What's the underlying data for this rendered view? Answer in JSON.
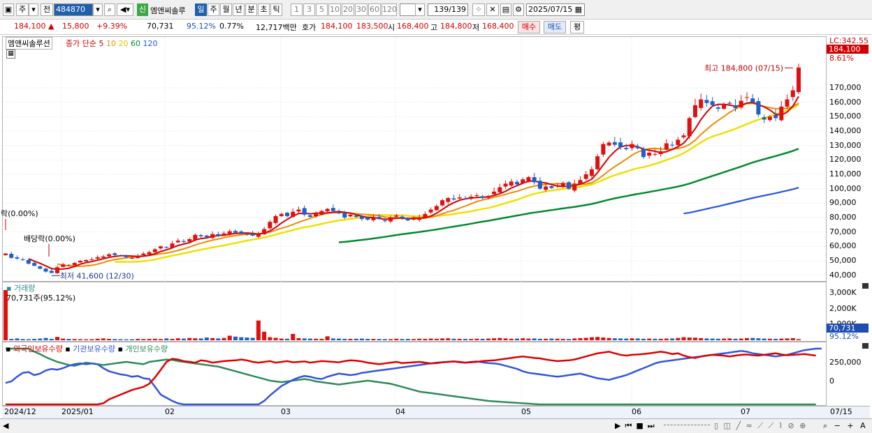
{
  "toolbar": {
    "market": "주",
    "prefix": "전",
    "code": "484870",
    "new_badge": "신",
    "stock_name": "엠앤씨솔루",
    "periods": [
      "일",
      "주",
      "월",
      "년",
      "분",
      "초",
      "틱"
    ],
    "selected_period": "일",
    "intervals": [
      "1",
      "3",
      "5",
      "10",
      "20",
      "30",
      "60",
      "120"
    ],
    "count": "139",
    "total": "/139",
    "date": "2025/07/15"
  },
  "quote": {
    "price": "184,100",
    "change": "15,800",
    "pct": "+9.39%",
    "volume": "70,731",
    "vol_ratio": "95.12%",
    "turnover": "0.77%",
    "amount": "12,717백만",
    "hoga_label": "호가",
    "hoga_bid": "184,100",
    "hoga_ask": "183,500",
    "open_label": "시",
    "open": "168,400",
    "high_label": "고",
    "high": "184,800",
    "low_label": "저",
    "low": "168,400",
    "buy": "매수",
    "sell": "매도",
    "avg": "평"
  },
  "chart_data": [
    {
      "type": "candlestick",
      "title": "엠앤씨솔루션",
      "legend": [
        "종가 단순 5",
        "10",
        "20",
        "60",
        "120"
      ],
      "legend_colors": [
        "#d00000",
        "#ee8a00",
        "#f0e000",
        "#008a2e",
        "#2255dd"
      ],
      "series_5_10_20": [
        "5",
        "10",
        "20"
      ],
      "current_marker": "184,100",
      "lc_label": "LC:342.55",
      "pct_label": "8.61%",
      "annotations": {
        "high": "최고 184,800 (07/15)",
        "low": "최저 41,600 (12/30)",
        "div1": "배당락(0.00%)",
        "div2": "락(0.00%)"
      },
      "ylim": [
        35000,
        190000
      ],
      "yticks": [
        "170,000",
        "160,000",
        "150,000",
        "140,000",
        "130,000",
        "120,000",
        "110,000",
        "100,000",
        "90,000",
        "80,000",
        "70,000",
        "60,000",
        "50,000",
        "40,000"
      ],
      "close": [
        55000,
        52000,
        51500,
        50500,
        48000,
        46500,
        44500,
        42500,
        41600,
        45500,
        47500,
        47000,
        48500,
        50000,
        50500,
        51000,
        52500,
        53000,
        54500,
        54000,
        53500,
        52500,
        52000,
        53500,
        55000,
        56000,
        58000,
        60000,
        59000,
        62000,
        64000,
        63000,
        65000,
        68000,
        67000,
        66500,
        68500,
        67500,
        69000,
        70500,
        69500,
        69000,
        68500,
        67500,
        68500,
        72000,
        77000,
        81000,
        82500,
        81000,
        84000,
        85500,
        82000,
        80500,
        83000,
        84500,
        86000,
        84500,
        83000,
        80000,
        82000,
        80500,
        79000,
        78500,
        80000,
        79000,
        77500,
        80000,
        81500,
        79500,
        78000,
        79000,
        80000,
        82500,
        85500,
        88000,
        92000,
        93500,
        92500,
        94000,
        93000,
        94500,
        95500,
        93500,
        95000,
        98000,
        101000,
        103500,
        105000,
        103000,
        106500,
        108000,
        104500,
        100000,
        101500,
        100500,
        102500,
        104000,
        100000,
        103500,
        106000,
        110000,
        113500,
        122500,
        131000,
        132000,
        130500,
        129000,
        127500,
        131000,
        128000,
        122000,
        125000,
        124000,
        126000,
        131500,
        130000,
        134000,
        137000,
        149000,
        158000,
        162000,
        159500,
        158000,
        155500,
        158000,
        159000,
        156000,
        161000,
        163500,
        160000,
        151500,
        148000,
        150000,
        149000,
        157000,
        162000,
        168300,
        184100
      ],
      "ma60_start_index": 58,
      "ma120_start_index": 118
    },
    {
      "type": "bar",
      "title": "거래량",
      "annotation": "70,731주(95.12%)",
      "yticks": [
        "3,000K",
        "2,000K",
        "1,000K"
      ],
      "current_label": "70,731",
      "current_pct": "95.12%",
      "values_k": [
        3300,
        90,
        120,
        80,
        70,
        90,
        110,
        150,
        95,
        220,
        110,
        90,
        80,
        70,
        60,
        70,
        100,
        120,
        90,
        80,
        70,
        60,
        70,
        90,
        80,
        90,
        100,
        80,
        120,
        90,
        130,
        110,
        150,
        130,
        120,
        180,
        140,
        120,
        150,
        300,
        240,
        200,
        180,
        160,
        1300,
        560,
        200,
        160,
        110,
        100,
        420,
        140,
        120,
        110,
        100,
        90,
        260,
        120,
        110,
        95,
        90,
        100,
        110,
        95,
        90,
        85,
        80,
        75,
        100,
        85,
        90,
        80,
        100,
        90,
        110,
        95,
        120,
        130,
        100,
        95,
        90,
        85,
        100,
        95,
        110,
        130,
        150,
        120,
        100,
        110,
        130,
        110,
        120,
        100,
        95,
        110,
        100,
        90,
        85,
        120,
        140,
        160,
        200,
        220,
        180,
        150,
        130,
        120,
        110,
        130,
        120,
        100,
        110,
        100,
        95,
        110,
        120,
        150,
        200,
        180,
        170,
        140,
        120,
        110,
        100,
        110,
        120,
        100,
        110,
        140,
        150,
        130,
        110,
        100,
        95,
        110,
        120,
        140,
        70
      ]
    },
    {
      "type": "line",
      "title": "외국인보유수량",
      "legend": [
        "외국인보유수량",
        "기관보유수량",
        "개인보유수량"
      ],
      "legend_colors": [
        "#dd0000",
        "#3355dd",
        "#2e8b57"
      ],
      "yticks": [
        "250,000",
        "0"
      ],
      "foreign": [
        -560000,
        -580000,
        -600000,
        -590000,
        -620000,
        -630000,
        -610000,
        -600000,
        -590000,
        -560000,
        -540000,
        -520000,
        -500000,
        -470000,
        -430000,
        -380000,
        -330000,
        -280000,
        -230000,
        -200000,
        -170000,
        -140000,
        -110000,
        -90000,
        -70000,
        -30000,
        50000,
        150000,
        250000,
        290000,
        280000,
        260000,
        250000,
        240000,
        270000,
        260000,
        240000,
        250000,
        260000,
        265000,
        270000,
        280000,
        270000,
        250000,
        240000,
        250000,
        260000,
        240000,
        250000,
        260000,
        245000,
        250000,
        255000,
        240000,
        250000,
        260000,
        255000,
        250000,
        245000,
        260000,
        270000,
        265000,
        255000,
        240000,
        230000,
        220000,
        230000,
        240000,
        250000,
        235000,
        240000,
        245000,
        250000,
        240000,
        230000,
        235000,
        245000,
        250000,
        255000,
        250000,
        240000,
        245000,
        250000,
        260000,
        265000,
        270000,
        280000,
        290000,
        300000,
        310000,
        320000,
        310000,
        300000,
        295000,
        280000,
        270000,
        260000,
        265000,
        270000,
        280000,
        300000,
        320000,
        340000,
        360000,
        370000,
        380000,
        360000,
        340000,
        330000,
        340000,
        345000,
        350000,
        360000,
        370000,
        380000,
        370000,
        350000,
        360000,
        330000,
        310000,
        300000,
        320000,
        330000,
        340000,
        335000,
        330000,
        320000,
        330000,
        340000,
        345000,
        335000,
        330000,
        340000,
        350000,
        360000,
        345000,
        335000,
        340000,
        345000,
        350000,
        340000,
        330000
      ],
      "institution": [
        -20000,
        0,
        60000,
        110000,
        120000,
        80000,
        100000,
        140000,
        160000,
        150000,
        170000,
        200000,
        220000,
        230000,
        220000,
        230000,
        220000,
        170000,
        130000,
        110000,
        90000,
        80000,
        60000,
        70000,
        40000,
        30000,
        -70000,
        -170000,
        -210000,
        -250000,
        -280000,
        -310000,
        -420000,
        -480000,
        -530000,
        -580000,
        -600000,
        -590000,
        -580000,
        -560000,
        -530000,
        -490000,
        -460000,
        -400000,
        -340000,
        -250000,
        -180000,
        -120000,
        -60000,
        -20000,
        20000,
        50000,
        70000,
        60000,
        40000,
        30000,
        60000,
        80000,
        100000,
        90000,
        80000,
        90000,
        110000,
        120000,
        130000,
        140000,
        150000,
        160000,
        170000,
        180000,
        190000,
        200000,
        210000,
        220000,
        230000,
        240000,
        245000,
        250000,
        255000,
        245000,
        240000,
        250000,
        255000,
        245000,
        235000,
        230000,
        220000,
        200000,
        180000,
        160000,
        130000,
        110000,
        100000,
        90000,
        80000,
        70000,
        60000,
        70000,
        80000,
        90000,
        100000,
        80000,
        60000,
        40000,
        30000,
        20000,
        40000,
        60000,
        80000,
        110000,
        140000,
        170000,
        200000,
        230000,
        250000,
        260000,
        270000,
        280000,
        290000,
        300000,
        310000,
        320000,
        330000,
        340000,
        350000,
        360000,
        370000,
        380000,
        390000,
        380000,
        360000,
        350000,
        340000,
        330000,
        320000,
        330000,
        340000,
        360000,
        380000,
        400000,
        410000,
        420000,
        430000
      ],
      "individual": [
        450000,
        460000,
        440000,
        430000,
        420000,
        380000,
        350000,
        310000,
        280000,
        250000,
        230000,
        210000,
        200000,
        220000,
        240000,
        230000,
        220000,
        210000,
        220000,
        230000,
        240000,
        250000,
        240000,
        230000,
        220000,
        250000,
        260000,
        270000,
        280000,
        275000,
        260000,
        250000,
        240000,
        230000,
        220000,
        210000,
        200000,
        190000,
        170000,
        150000,
        130000,
        110000,
        90000,
        70000,
        50000,
        30000,
        10000,
        0,
        -10000,
        0,
        10000,
        20000,
        30000,
        20000,
        0,
        -10000,
        -20000,
        -30000,
        -40000,
        -30000,
        -20000,
        -10000,
        0,
        10000,
        0,
        -10000,
        -20000,
        -30000,
        -50000,
        -70000,
        -90000,
        -110000,
        -130000,
        -140000,
        -150000,
        -160000,
        -170000,
        -180000,
        -190000,
        -200000,
        -210000,
        -220000,
        -230000,
        -240000,
        -250000,
        -255000,
        -260000,
        -265000,
        -270000,
        -275000,
        -280000,
        -285000,
        -290000,
        -295000,
        -300000,
        -305000,
        -310000,
        -315000,
        -320000,
        -325000,
        -330000,
        -335000,
        -340000,
        -345000,
        -350000,
        -355000,
        -360000,
        -365000,
        -370000,
        -375000,
        -380000,
        -385000,
        -390000,
        -395000,
        -400000,
        -405000,
        -410000,
        -415000,
        -420000,
        -425000,
        -430000,
        -435000,
        -440000,
        -445000,
        -450000,
        -455000,
        -460000,
        -465000,
        -470000,
        -475000,
        -480000,
        -485000,
        -490000,
        -495000,
        -500000,
        -505000,
        -510000,
        -520000,
        -530000,
        -540000,
        -560000,
        -580000
      ]
    }
  ],
  "x_axis": {
    "labels": [
      "2024/12",
      "2025/01",
      "02",
      "03",
      "04",
      "05",
      "06",
      "07"
    ],
    "current": "07/15"
  }
}
